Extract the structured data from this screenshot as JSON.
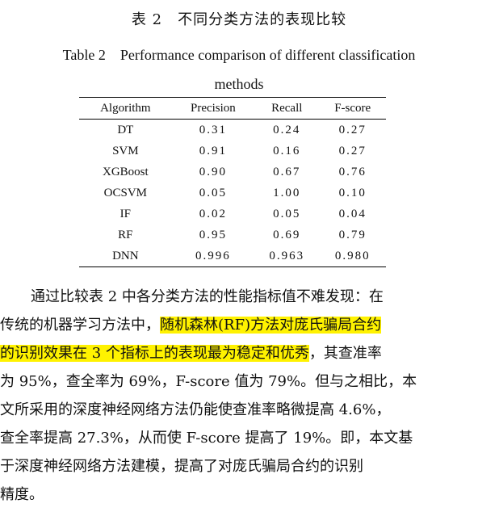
{
  "caption_cn": "表 2　不同分类方法的表现比较",
  "caption_en_line1": "Table 2　Performance comparison of different classification",
  "caption_en_line2": "methods",
  "table": {
    "headers": [
      "Algorithm",
      "Precision",
      "Recall",
      "F-score"
    ],
    "rows": [
      [
        "DT",
        "0.31",
        "0.24",
        "0.27"
      ],
      [
        "SVM",
        "0.91",
        "0.16",
        "0.27"
      ],
      [
        "XGBoost",
        "0.90",
        "0.67",
        "0.76"
      ],
      [
        "OCSVM",
        "0.05",
        "1.00",
        "0.10"
      ],
      [
        "IF",
        "0.02",
        "0.05",
        "0.04"
      ],
      [
        "RF",
        "0.95",
        "0.69",
        "0.79"
      ],
      [
        "DNN",
        "0.996",
        "0.963",
        "0.980"
      ]
    ]
  },
  "paragraph": {
    "l1": "通过比较表 2 中各分类方法的性能指标值不难发现：在",
    "l2a": "传统的机器学习方法中，",
    "l2b": "随机森林(RF)方法对庞氏骗局合约",
    "l3a": "的识别效果在 3 个指标上的表现最为稳定和优秀",
    "l3b": "，其查准率",
    "l4": "为 95%，查全率为 69%，F-score 值为 79%。但与之相比，本",
    "l5": "文所采用的深度神经网络方法仍能使查准率略微提高 4.6%，",
    "l6": "查全率提高 27.3%，从而使 F-score 提高了 19%。即，本文基",
    "l7": "于深度神经网络方法建模，提高了对庞氏骗局合约的识别",
    "l8": "精度。"
  },
  "colors": {
    "highlight": "#fff200"
  }
}
